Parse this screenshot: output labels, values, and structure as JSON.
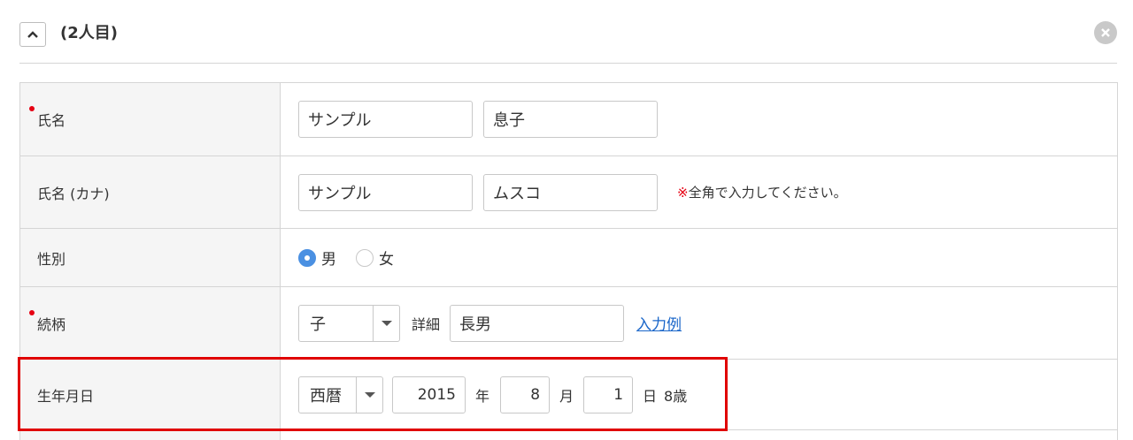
{
  "header": {
    "title": "(2人目)",
    "colors": {
      "remove_button": "#c9c9c9",
      "divider": "#d5d5d5"
    }
  },
  "form": {
    "name": {
      "label": "氏名",
      "required": true,
      "last_name": "サンプル",
      "first_name": "息子"
    },
    "kana": {
      "label": "氏名 (カナ)",
      "last_name": "サンプル",
      "first_name": "ムスコ",
      "note_mark": "※",
      "note": "全角で入力してください。"
    },
    "gender": {
      "label": "性別",
      "options": [
        "男",
        "女"
      ],
      "selected": "男"
    },
    "relation": {
      "label": "続柄",
      "required": true,
      "select_value": "子",
      "detail_label": "詳細",
      "detail_value": "長男",
      "example_link": "入力例"
    },
    "birthdate": {
      "label": "生年月日",
      "era": "西暦",
      "year": "2015",
      "year_unit": "年",
      "month": "8",
      "month_unit": "月",
      "day": "1",
      "day_unit": "日",
      "age": "8歳"
    }
  },
  "colors": {
    "required_dot": "#e60012",
    "radio_checked": "#4a90e2",
    "link": "#1a66c9",
    "highlight": "#e00000",
    "label_bg": "#f5f5f5"
  }
}
